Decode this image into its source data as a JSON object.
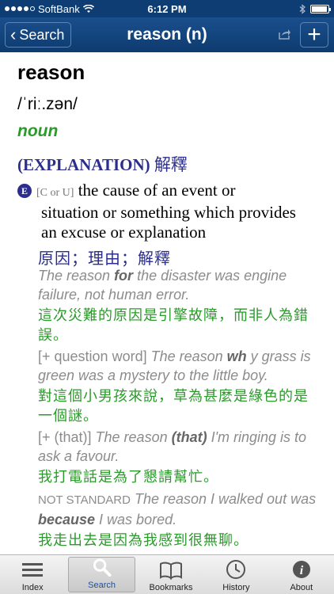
{
  "status": {
    "carrier": "SoftBank",
    "time": "6:12 PM",
    "battery_level": 0.95
  },
  "nav": {
    "back_label": "Search",
    "title": "reason (n)",
    "add_label": "+"
  },
  "entry": {
    "headword": "reason",
    "pronunciation": "/ˈriː.zən/",
    "part_of_speech": "noun",
    "sense_heading_en": "(EXPLANATION)",
    "sense_heading_zh": "解釋",
    "level_badge": "E",
    "grammar": "[C or U]",
    "definition_line1": "the cause of an event or",
    "definition_line2": "situation or something which provides",
    "definition_line3": "an excuse or explanation",
    "definition_zh": "原因；理由；解釋",
    "examples": [
      {
        "en_pre": "The reason ",
        "en_bold": "for",
        "en_post": " the disaster was engine failure, not human error.",
        "zh": "這次災難的原因是引擎故障，而非人為錯誤。"
      },
      {
        "label": "[+ question word]",
        "en_pre": " The reason ",
        "en_bold": "wh",
        "en_post": " y grass is green was a mystery to the little boy.",
        "zh": "對這個小男孩來說，草為甚麼是綠色的是一個謎。"
      },
      {
        "label": "[+ (that)]",
        "en_pre": " The reason ",
        "en_bold": "(that)",
        "en_post": " I'm ringing is to ask a favour.",
        "zh": "我打電話是為了懇請幫忙。"
      },
      {
        "label": "NOT STANDARD",
        "en_pre": " The reason I walked out was ",
        "en_bold": "because",
        "en_post": " I was bored.",
        "zh": "我走出去是因為我感到很無聊。"
      }
    ]
  },
  "tabs": [
    {
      "label": "Index",
      "icon": "list-icon"
    },
    {
      "label": "Search",
      "icon": "magnifier-icon"
    },
    {
      "label": "Bookmarks",
      "icon": "book-icon"
    },
    {
      "label": "History",
      "icon": "clock-icon"
    },
    {
      "label": "About",
      "icon": "info-icon"
    }
  ]
}
